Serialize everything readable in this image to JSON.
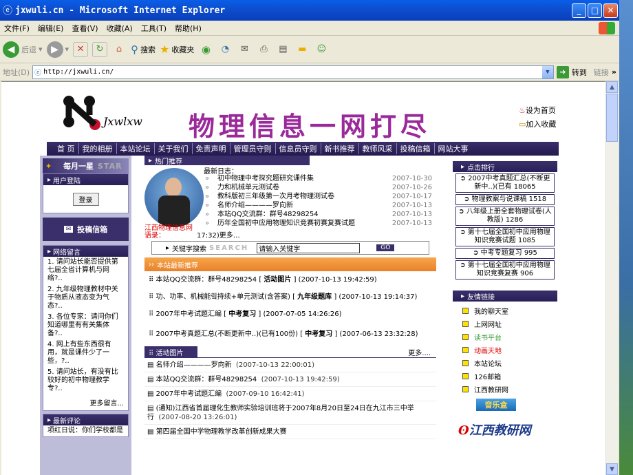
{
  "window": {
    "title": "jxwuli.cn - Microsoft Internet Explorer"
  },
  "menu": [
    "文件(F)",
    "编辑(E)",
    "查看(V)",
    "收藏(A)",
    "工具(T)",
    "帮助(H)"
  ],
  "toolbar": {
    "back": "后退",
    "search": "搜索",
    "favorites": "收藏夹"
  },
  "address": {
    "label": "地址(D)",
    "url": "http://jxwuli.cn/",
    "go": "转到",
    "links": "链接"
  },
  "header": {
    "logo_text": "Jxwlxw",
    "banner": "物理信息一网打尽",
    "set_home": "设为首页",
    "add_fav": "加入收藏"
  },
  "nav": [
    "首 页",
    "我的相册",
    "本站论坛",
    "关于我们",
    "免责声明",
    "管理员守则",
    "信息员守则",
    "新书推荐",
    "教师风采",
    "投稿信箱",
    "网站大事"
  ],
  "left": {
    "star_title": "每月一星",
    "star_tag": "STAR",
    "login_head": "用户登陆",
    "login_btn": "登录",
    "submit_btn": "投稿信箱",
    "msg_head": "网络留言",
    "messages": [
      "1. 请问站长能否提供第七届全省计算机与网络?..",
      "2. 九年级物理教材中关于物质从液态变为气态?..",
      "3. 各位专家：请问你们知道哪里有有关集体备?..",
      "4. 网上有些东西很有用，就是课件少了一些，?..",
      "5. 请问站长，有没有比较好的初中物理教学专?.."
    ],
    "more_msg": "更多留言...",
    "review_head": "最新评论",
    "review_text": "项红日说：你们学校都是"
  },
  "hot": {
    "head": "热门推荐",
    "log_title": "最新日志：",
    "items": [
      {
        "title": "初中物理中考探究题研究课件集",
        "date": "2007-10-30"
      },
      {
        "title": "力和机械单元测试卷",
        "date": "2007-10-26"
      },
      {
        "title": "教科版初三年级第一次月考物理测试卷",
        "date": "2007-10-17"
      },
      {
        "title": "名师介绍————罗向新",
        "date": "2007-10-13"
      },
      {
        "title": "本站QQ交流群：群号48298254",
        "date": "2007-10-13"
      },
      {
        "title": "历年全国初中应用物理知识竞赛初赛复赛试题",
        "date": "2007-10-13"
      }
    ],
    "site_name": "江西物理信息网语录：",
    "time_more": "17:32)更多…",
    "kw_label": "关键字搜索",
    "kw_search": "SEARCH",
    "kw_placeholder": "请输入关键字",
    "kw_go": "GO"
  },
  "latest": {
    "head": "本站最新推荐",
    "items": [
      {
        "pre": "本站QQ交流群：群号48298254 [ ",
        "cat": "活动图片",
        "post": " ] (2007-10-13 19:42:59)"
      },
      {
        "pre": "功、功率、机械能맄持续+单元测试(含答案) [ ",
        "cat": "九年级题库",
        "post": " ] (2007-10-13 19:14:37)"
      },
      {
        "pre": "2007年中考试题汇编 [ ",
        "cat": "中考复习",
        "post": " ] (2007-07-05 14:26:26)"
      },
      {
        "pre": "2007中考真题汇总(不断更新中..)(已有100份) [ ",
        "cat": "中考复习",
        "post": " ] (2007-06-13 23:32:28)"
      }
    ]
  },
  "activity": {
    "head": "活动图片",
    "more": "更多....",
    "items": [
      {
        "title": "名师介绍————罗向新",
        "date": "(2007-10-13 22:00:01)"
      },
      {
        "title": "本站QQ交流群：群号48298254",
        "date": "(2007-10-13 19:42:59)"
      },
      {
        "title": "2007年中考试题汇编",
        "date": "(2007-09-10 16:42:41)"
      },
      {
        "title": "(通知)江西省首届理化生教师实验培训班将于2007年8月20日至24日在九江市三中举行",
        "date": "(2007-08-20 13:26:01)"
      },
      {
        "title": "第四届全国中学物理教学改革创新成果大赛",
        "date": ""
      }
    ]
  },
  "rank": {
    "head": "点击排行",
    "items": [
      "2007中考真题汇总(不断更新中..)(已有 18065",
      "物理教案与说课稿 1518",
      "八年级上册全套物理试卷(人教版) 1286",
      "第十七届全国初中应用物理知识竞赛试题 1085",
      "中考专题复习 995",
      "第十七届全国初中应用物理知识竞赛复赛 906"
    ]
  },
  "friends": {
    "head": "友情链接",
    "items": [
      "我的聊天室",
      "上网网址",
      "读书平台",
      "动画天地",
      "本站论坛",
      "126邮箱",
      "江西教研网"
    ],
    "music": "音乐盒",
    "jx_logo": "江西教研网"
  }
}
